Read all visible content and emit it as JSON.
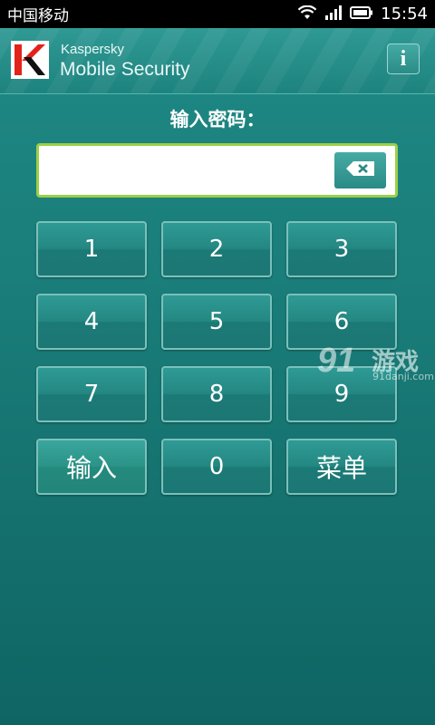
{
  "status_bar": {
    "carrier": "中国移动",
    "time": "15:54",
    "icons": [
      "wifi-icon",
      "signal-icon",
      "battery-icon"
    ]
  },
  "header": {
    "brand_small": "Kaspersky",
    "brand_large": "Mobile Security",
    "info_label": "i",
    "logo_icon": "kaspersky-k-logo"
  },
  "prompt": "输入密码：",
  "password_field": {
    "value": "",
    "backspace_icon": "backspace-icon"
  },
  "keypad": {
    "k1": "1",
    "k2": "2",
    "k3": "3",
    "k4": "4",
    "k5": "5",
    "k6": "6",
    "k7": "7",
    "k8": "8",
    "k9": "9",
    "enter": "输入",
    "k0": "0",
    "menu": "菜单"
  },
  "watermark": {
    "logo_text": "91",
    "title": "游戏",
    "url": "91danji.com"
  },
  "colors": {
    "background": "#1a7d79",
    "field_border": "#9ccf47",
    "logo_red": "#e2231a"
  }
}
